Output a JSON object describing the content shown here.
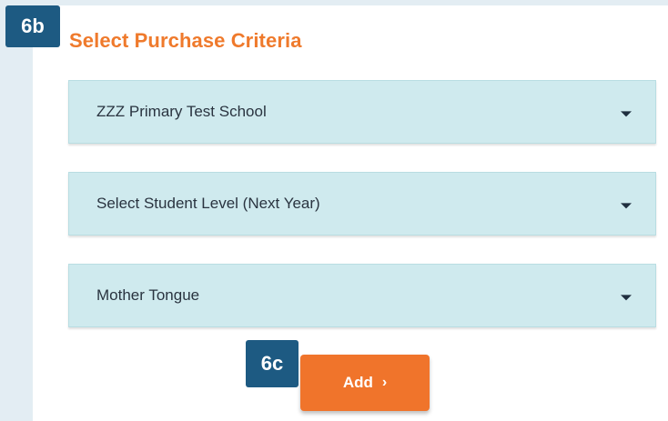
{
  "badges": {
    "criteria": "6b",
    "add": "6c"
  },
  "section": {
    "title": "Select Purchase Criteria"
  },
  "selects": {
    "school": {
      "value": "ZZZ Primary Test School"
    },
    "level": {
      "value": "Select Student Level (Next Year)"
    },
    "tongue": {
      "value": "Mother Tongue"
    }
  },
  "actions": {
    "add_label": "Add",
    "add_chevron": "›"
  },
  "icons": {
    "dropdown": "caret-down-icon",
    "add": "chevron-right-icon"
  },
  "colors": {
    "accent": "#ef7a2c",
    "button": "#f0742b",
    "badge": "#1d5a82",
    "select_bg": "#cfeaee"
  }
}
